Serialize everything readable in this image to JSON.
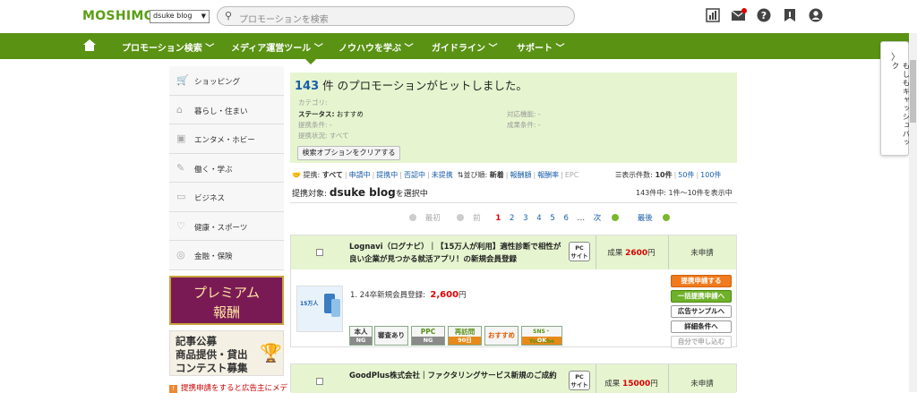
{
  "header": {
    "logo": "MOSHIMO",
    "site_select": "dsuke blog",
    "search_placeholder": "プロモーションを検索",
    "icons": [
      "report-icon",
      "mail-icon",
      "help-icon",
      "bookmark-icon",
      "user-icon"
    ]
  },
  "nav": {
    "items": [
      "プロモーション検索",
      "メディア運営ツール",
      "ノウハウを学ぶ",
      "ガイドライン",
      "サポート"
    ]
  },
  "side_tab": {
    "label": "もしもキャッシュバック"
  },
  "sidebar": {
    "categories": [
      "ショッピング",
      "暮らし・住まい",
      "エンタメ・ホビー",
      "働く・学ぶ",
      "ビジネス",
      "健康・スポーツ",
      "金融・保険"
    ],
    "banner1_line1": "プレミアム",
    "banner1_line2": "報酬",
    "banner2_line1": "記事公募",
    "banner2_line2": "商品提供・貸出",
    "banner2_line3": "コンテスト募集",
    "notice": "提携申請をすると広告主にメデ"
  },
  "summary": {
    "count": "143",
    "hit_text": "件 のプロモーションがヒットしました。",
    "category_label": "カテゴリ:",
    "status_label": "ステータス:",
    "status_value": "おすすめ",
    "condition_label": "提携条件:",
    "condition_value": "-",
    "state_label": "提携状況:",
    "state_value": "すべて",
    "device_label": "対応機能:",
    "device_value": "-",
    "result_label": "成果条件:",
    "result_value": "-",
    "clear_button": "検索オプションをクリアする"
  },
  "options": {
    "partner_label": "提携:",
    "partner_all": "すべて",
    "partner_opts": [
      "申請中",
      "提携中",
      "否認中",
      "未提携"
    ],
    "sort_label": "並び順:",
    "sort_current": "新着",
    "sort_opts": [
      "報酬額",
      "報酬率",
      "EPC"
    ],
    "per_label": "表示件数:",
    "per_current": "10件",
    "per_opts": [
      "50件",
      "100件"
    ]
  },
  "target": {
    "prefix": "提携対象:",
    "blog": "dsuke blog",
    "suffix": "を選択中",
    "count_text": "143件中: 1件〜10件を表示中"
  },
  "pager": {
    "first": "最初",
    "prev": "前",
    "current": "1",
    "pages": [
      "2",
      "3",
      "4",
      "5",
      "6"
    ],
    "ellipsis": "…",
    "next": "次",
    "last": "最後"
  },
  "cards": [
    {
      "title": "Lognavi（ログナビ）｜【15万人が利用】適性診断で相性が良い企業が見つかる就活アプリ！の新規会員登録",
      "badge_line1": "PC",
      "badge_line2": "サイト",
      "reward_label": "成果",
      "reward_value": "2600",
      "reward_unit": "円",
      "status": "未申請",
      "thumb_text": "15万人",
      "item_text": "1. 24卒新規会員登録:",
      "item_amount": "2,600",
      "item_unit": "円",
      "tags": [
        {
          "t1": "本人",
          "t2": "NG"
        },
        {
          "t1": "審査あり",
          "t2": ""
        },
        {
          "t1": "PPC",
          "t2": "NG"
        },
        {
          "t1": "再訪問",
          "t2": "90日"
        },
        {
          "t1": "おすすめ",
          "t2": ""
        },
        {
          "t1": "SNS・YouTube",
          "t2": "OK"
        }
      ],
      "buttons": [
        "提携申請する",
        "一括提携申請へ",
        "広告サンプルへ",
        "詳細条件へ",
        "自分で申し込む"
      ]
    },
    {
      "title": "GoodPlus株式会社｜ファクタリングサービス新規のご成約",
      "badge_line1": "PC",
      "badge_line2": "サイト",
      "reward_label": "成果",
      "reward_value": "15000",
      "reward_unit": "円",
      "status": "未申請"
    }
  ],
  "colors": {
    "brand_green": "#5a9214",
    "light_green": "#e6f5cf",
    "link_blue": "#1a5ea8",
    "accent_red": "#d00000",
    "apply_orange": "#f07a1c"
  }
}
